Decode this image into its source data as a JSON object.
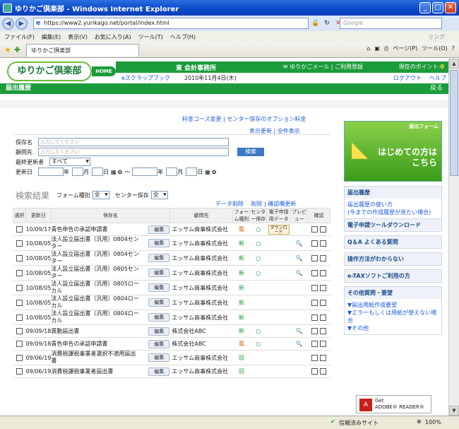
{
  "window": {
    "title": "ゆりかご倶楽部 - Windows Internet Explorer",
    "minimize": "_",
    "maximize": "□",
    "close": "✕"
  },
  "address": {
    "url": "https://www2.yurikago.net/portal/index.html",
    "search_placeholder": "Google"
  },
  "menu": [
    "ファイル(F)",
    "編集(E)",
    "表示(V)",
    "お気に入り(A)",
    "ツール(T)",
    "ヘルプ(H)"
  ],
  "menu_link": "リンク",
  "tab": {
    "label": "ゆりかご倶楽部"
  },
  "tools": {
    "page": "ページ(P)",
    "tools": "ツール(O)"
  },
  "site": {
    "logo": "ゆりかご倶楽部",
    "home": "HOME",
    "office": "東 会計事務所",
    "mail": "ゆりかごメール",
    "register": "ご利用登録",
    "points_label": "現在のポイント:",
    "points_value": "0",
    "escrap": "eスクラップブック",
    "date": "2010年11月4日(木)",
    "logout": "ログアウト",
    "help": "ヘルプ"
  },
  "crumb": {
    "title": "届出履歴",
    "back": "戻る"
  },
  "links": {
    "course_change": "料金コース変更",
    "option_fee": "センター保存のオプション料金",
    "refresh": "表示更新",
    "show_all": "全件表示"
  },
  "search": {
    "name_label": "保存名",
    "name_ph": "入力してください",
    "client_label": "顧問先",
    "client_ph": "入力してください",
    "updater_label": "最終更新者",
    "updater_value": "すべて",
    "date_label": "更新日",
    "year": "年",
    "month": "月",
    "day": "日",
    "tilde": "〜",
    "button": "検索"
  },
  "results": {
    "title": "検索結果",
    "form_label": "フォーム種別",
    "form_value": "全",
    "center_label": "センター保存",
    "center_value": "全",
    "data_delete": "データ削除",
    "delete": "削除",
    "confirm_update": "確認欄更新"
  },
  "table": {
    "headers": {
      "select": "選択",
      "updated": "更新日",
      "name": "保存名",
      "client": "顧問先",
      "form": "フォーム種別",
      "center": "センター保存",
      "edata": "電子申請用データ",
      "preview": "プレビュー",
      "confirm": "確認",
      "c1": "1",
      "c2": "2"
    },
    "edit": "編集",
    "download": "ダウンロード",
    "rows": [
      {
        "date": "10/09/17",
        "name": "青色申告の承認申請書",
        "client": "エッサム商事株式会社",
        "form": "電",
        "center": "○",
        "dl": true,
        "pv": false
      },
      {
        "date": "10/08/05",
        "name": "法人設立届出書（汎用）0804センター",
        "client": "エッサム商事株式会社",
        "form": "新",
        "center": "○",
        "dl": false,
        "pv": true
      },
      {
        "date": "10/08/05",
        "name": "法人設立届出書（汎用）0804センター",
        "client": "エッサム商事株式会社",
        "form": "新",
        "center": "○",
        "dl": false,
        "pv": true
      },
      {
        "date": "10/08/05",
        "name": "法人設立届出書（汎用）0805センター",
        "client": "エッサム商事株式会社",
        "form": "新",
        "center": "○",
        "dl": false,
        "pv": true
      },
      {
        "date": "10/08/05",
        "name": "法人設立届出書（汎用）0805ローカル",
        "client": "エッサム商事株式会社",
        "form": "新",
        "center": "",
        "dl": false,
        "pv": false
      },
      {
        "date": "10/08/05",
        "name": "法人設立届出書（汎用）0804ローカル",
        "client": "エッサム商事株式会社",
        "form": "新",
        "center": "",
        "dl": false,
        "pv": false
      },
      {
        "date": "10/08/05",
        "name": "法人設立届出書（汎用）0804ローカル",
        "client": "エッサム商事株式会社",
        "form": "新",
        "center": "",
        "dl": false,
        "pv": false
      },
      {
        "date": "09/09/18",
        "name": "異動届出書",
        "client": "株式会社ABC",
        "form": "新",
        "center": "○",
        "dl": false,
        "pv": true
      },
      {
        "date": "09/09/18",
        "name": "青色申告の承認申請書",
        "client": "株式会社ABC",
        "form": "電",
        "center": "○",
        "dl": false,
        "pv": true
      },
      {
        "date": "09/06/19",
        "name": "消費税課税事業者選択不適用届出書",
        "client": "エッサム商事株式会社",
        "form": "旧",
        "center": "",
        "dl": false,
        "pv": false
      },
      {
        "date": "09/06/19",
        "name": "消費税課税事業者届出書",
        "client": "エッサム商事株式会社",
        "form": "旧",
        "center": "",
        "dl": false,
        "pv": false
      }
    ]
  },
  "sidebar": {
    "banner_top": "届出フォーム",
    "banner_main": "はじめての方は\nこちら",
    "history_head": "届出履歴",
    "history_body": "届出履歴の使い方\n(今までの作成履歴が見たい場合)",
    "tool_dl": "電子申請ツールダウンロード",
    "qa": "Q＆A よくある質問",
    "unknown": "操作方法がわからない",
    "etax": "e-TAXソフトご利用の方",
    "other_head": "その他質問・要望",
    "other_body": "▼届出用紙作成要望\n▼エラーもしくは用紙が使えない場合\n▼その他",
    "adobe": "Get\nADOBE® READER®"
  },
  "status": {
    "zone": "信頼済みサイト",
    "zoom": "100%"
  }
}
